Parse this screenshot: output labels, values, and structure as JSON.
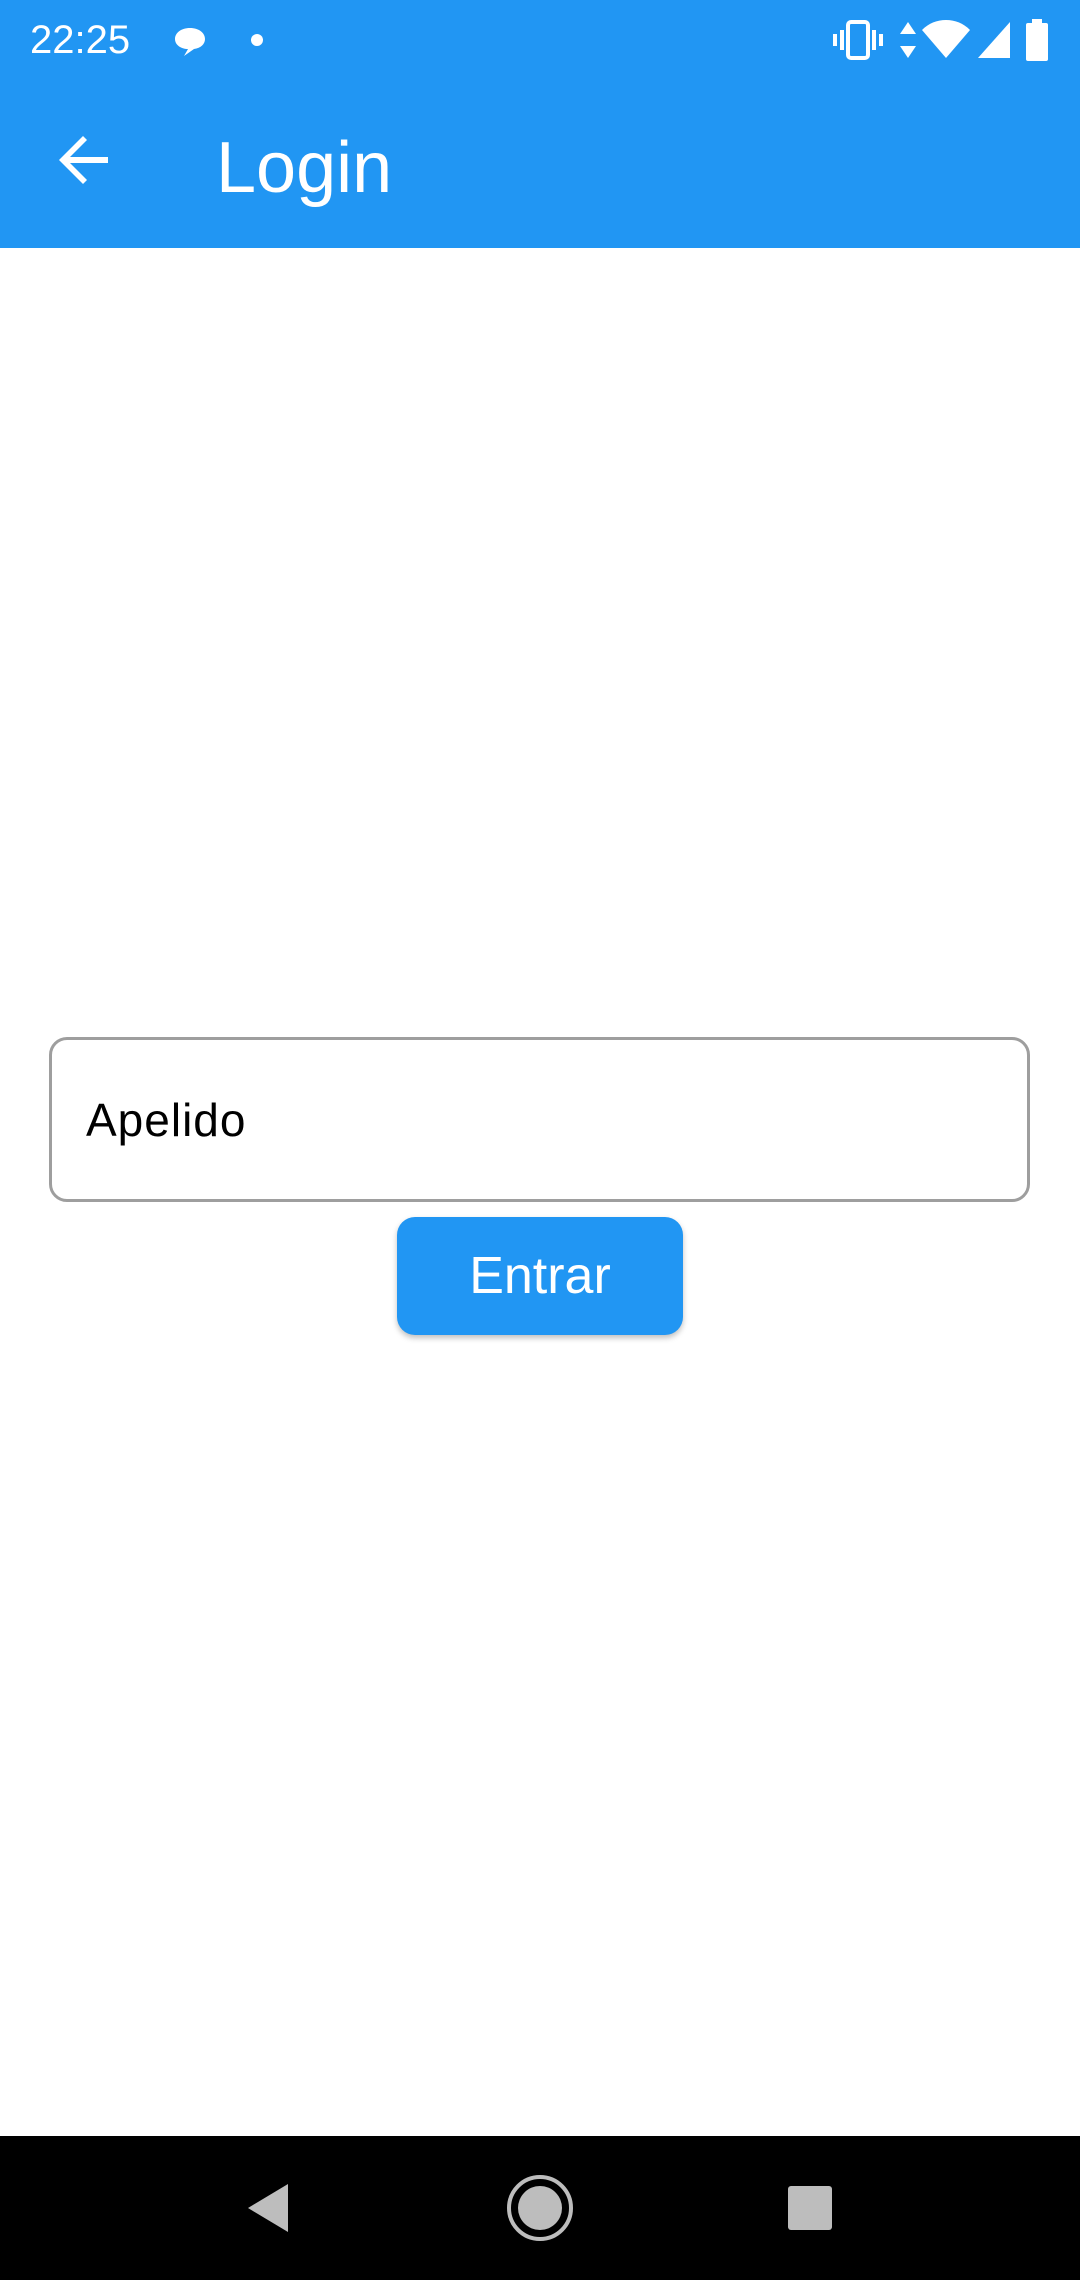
{
  "status_bar": {
    "time": "22:25",
    "icons": [
      "chat-bubble-icon",
      "notification-dot-icon",
      "vibrate-icon",
      "data-arrows-icon",
      "wifi-icon",
      "cell-signal-icon",
      "battery-icon"
    ]
  },
  "app_bar": {
    "title": "Login",
    "back_icon": "arrow-back-icon",
    "color": "#2196F3"
  },
  "form": {
    "surname_field": {
      "value": "Apelido",
      "placeholder": ""
    },
    "enter_button_label": "Entrar"
  },
  "nav_bar": {
    "icons": [
      "back-triangle-icon",
      "home-circle-icon",
      "recents-square-icon"
    ]
  }
}
